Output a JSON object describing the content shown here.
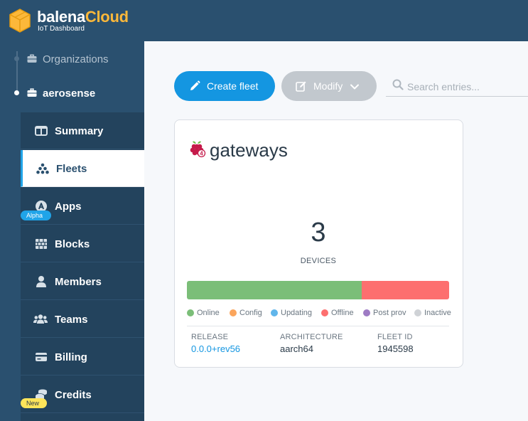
{
  "brand": {
    "name_part1": "balena",
    "name_part2": "Cloud",
    "subtitle": "IoT Dashboard"
  },
  "colors": {
    "header_bg": "#2a506f",
    "subnav_bg": "#23435d",
    "accent": "#1496e1",
    "logo": "#fcb83a",
    "online": "#7bbe78",
    "config": "#fba55c",
    "updating": "#61b6eb",
    "offline": "#fd6f6f",
    "post_prov": "#9e7bc4",
    "inactive": "#cfd2d6"
  },
  "orgs": {
    "organizations_label": "Organizations",
    "current_org": "aerosense"
  },
  "nav": {
    "items": [
      {
        "label": "Summary",
        "icon": "summary-icon"
      },
      {
        "label": "Fleets",
        "icon": "fleets-icon"
      },
      {
        "label": "Apps",
        "icon": "apps-icon"
      },
      {
        "label": "Blocks",
        "icon": "blocks-icon"
      },
      {
        "label": "Members",
        "icon": "member-icon"
      },
      {
        "label": "Teams",
        "icon": "teams-icon"
      },
      {
        "label": "Billing",
        "icon": "billing-icon"
      },
      {
        "label": "Credits",
        "icon": "credits-icon"
      }
    ],
    "active": "Fleets",
    "badge_alpha": "Alpha",
    "badge_new": "New"
  },
  "toolbar": {
    "create_label": "Create fleet",
    "modify_label": "Modify",
    "search_placeholder": "Search entries..."
  },
  "fleet": {
    "name": "gateways",
    "device_type_icon": "raspberry-pi-4-icon",
    "device_count": "3",
    "devices_label": "DEVICES",
    "status_fraction": {
      "online": 0.667,
      "offline": 0.333
    },
    "legend": [
      {
        "label": "Online",
        "color": "#7bbe78"
      },
      {
        "label": "Config",
        "color": "#fba55c"
      },
      {
        "label": "Updating",
        "color": "#61b6eb"
      },
      {
        "label": "Offline",
        "color": "#fd6f6f"
      },
      {
        "label": "Post prov",
        "color": "#9e7bc4"
      },
      {
        "label": "Inactive",
        "color": "#cfd2d6"
      }
    ],
    "release_label": "RELEASE",
    "release_value": "0.0.0+rev56",
    "architecture_label": "ARCHITECTURE",
    "architecture_value": "aarch64",
    "fleet_id_label": "FLEET ID",
    "fleet_id_value": "1945598"
  }
}
